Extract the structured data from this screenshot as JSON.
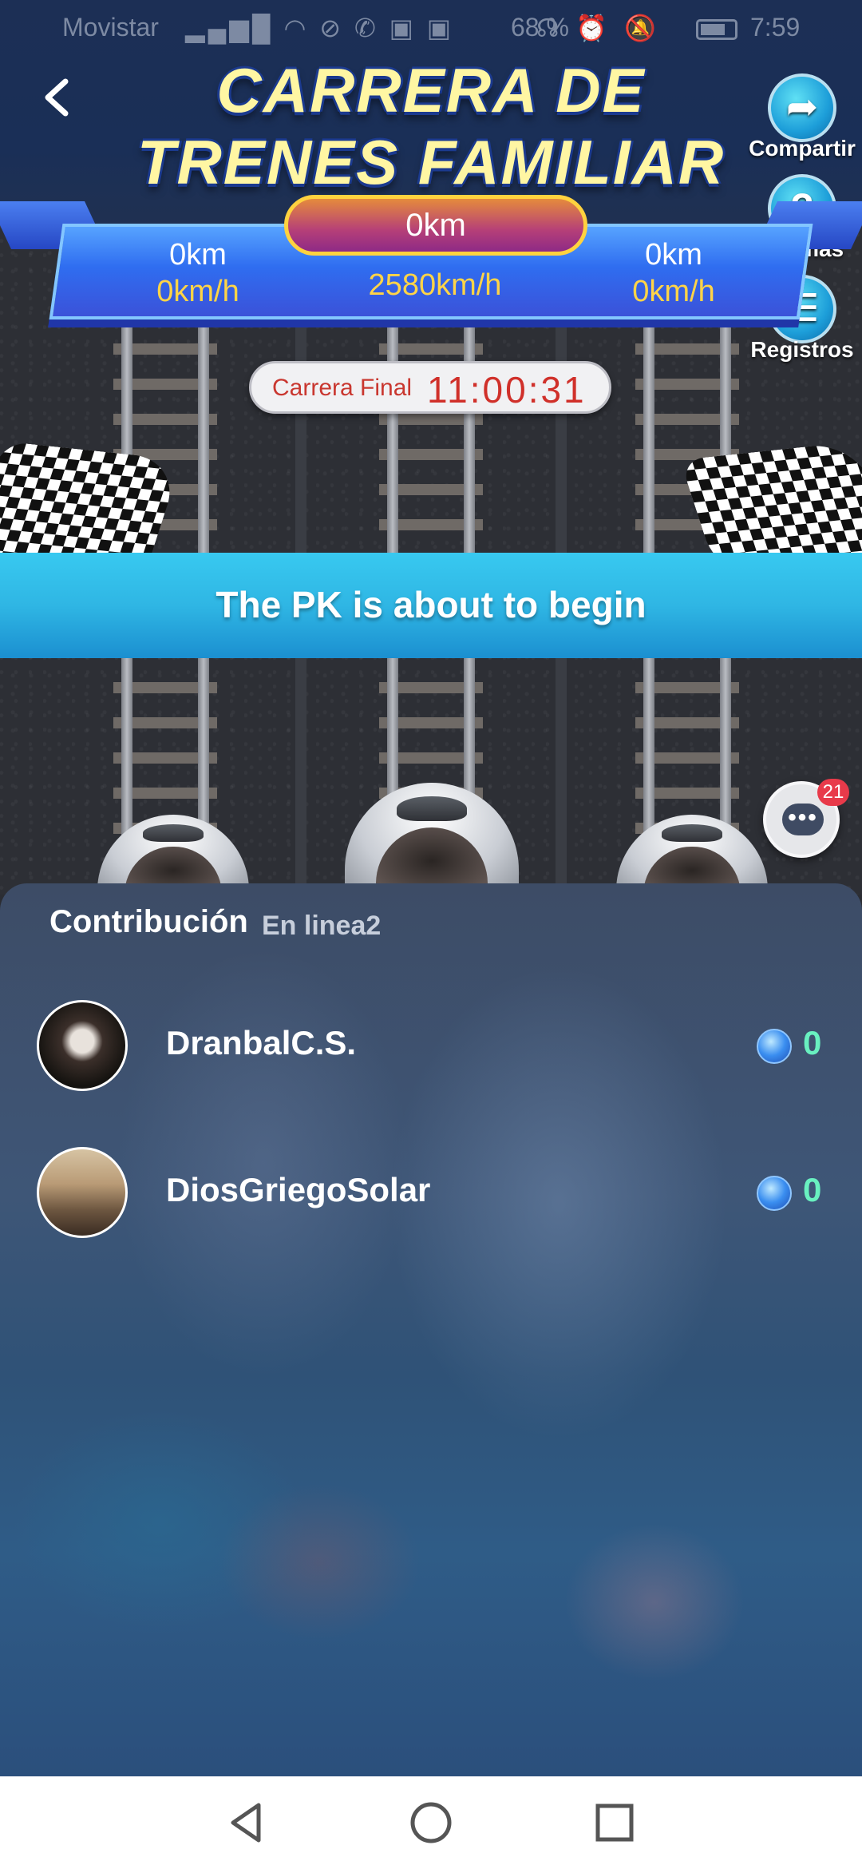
{
  "status_bar": {
    "carrier": "Movistar",
    "battery": "68 %",
    "time": "7:59"
  },
  "header": {
    "title_line1": "CARRERA DE",
    "title_line2": "TRENES FAMILIAR"
  },
  "actions": {
    "share": "Compartir",
    "rules": "Normas",
    "records": "Registros"
  },
  "race_board": {
    "center_distance": "0km",
    "left_distance": "0km",
    "left_speed": "0km/h",
    "center_speed": "2580km/h",
    "right_distance": "0km",
    "right_speed": "0km/h"
  },
  "timer": {
    "label": "Carrera Final",
    "value": "11:00:31"
  },
  "banner": {
    "text": "The PK is about to begin"
  },
  "chat": {
    "badge": "21"
  },
  "contribution": {
    "title": "Contribución",
    "subtitle": "En linea2",
    "rows": [
      {
        "name": "DranbalC.S.",
        "score": "0"
      },
      {
        "name": "DiosGriegoSolar",
        "score": "0"
      }
    ]
  },
  "colors": {
    "banner": "#2fb6e4",
    "score": "#69f0c0",
    "timer_text": "#d0302a",
    "title": "#fff6a3"
  }
}
